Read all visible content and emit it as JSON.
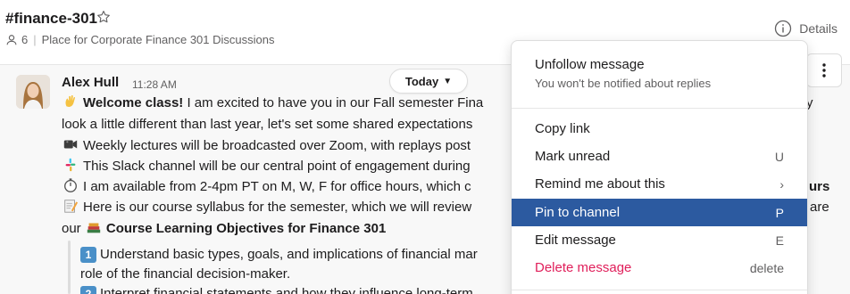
{
  "channel": {
    "name": "#finance-301",
    "member_count": "6",
    "description": "Place for Corporate Finance 301 Discussions",
    "details_label": "Details"
  },
  "date_pill": {
    "label": "Today"
  },
  "message": {
    "author": "Alex Hull",
    "time": "11:28 AM",
    "lines": [
      {
        "bold": "Welcome class!",
        "text": " I am excited to have you in our Fall semester Fina"
      },
      {
        "text": "look a little different than last year, let's set some shared expectations"
      },
      {
        "text": "Weekly lectures will be broadcasted over Zoom, with replays post"
      },
      {
        "text": "This Slack channel will be our central point of engagement during"
      },
      {
        "text": "I am available from 2-4pm PT on M, W, F for office hours, which c"
      },
      {
        "text": "Here is our course syllabus for the semester, which we will review"
      },
      {
        "prefix": "our",
        "bold": "Course Learning Objectives for Finance 301"
      }
    ],
    "objectives": [
      {
        "number": "1",
        "text": "Understand basic types, goals, and implications of financial mar"
      },
      {
        "text": "role of the financial decision-maker."
      },
      {
        "number": "2",
        "text": "Interpret financial statements and how they influence long-term"
      }
    ],
    "right_fragments": {
      "line1": "y",
      "line5": "urs",
      "line6": "are"
    }
  },
  "context_menu": {
    "unfollow": {
      "label": "Unfollow message",
      "sub": "You won't be notified about replies"
    },
    "items": [
      {
        "label": "Copy link",
        "shortcut": ""
      },
      {
        "label": "Mark unread",
        "shortcut": "U"
      },
      {
        "label": "Remind me about this",
        "shortcut": "›"
      },
      {
        "label": "Pin to channel",
        "shortcut": "P"
      },
      {
        "label": "Edit message",
        "shortcut": "E"
      },
      {
        "label": "Delete message",
        "shortcut": "delete"
      }
    ]
  },
  "colors": {
    "highlight": "#2c5aa0",
    "danger": "#e01e5a",
    "muted": "#616061"
  }
}
